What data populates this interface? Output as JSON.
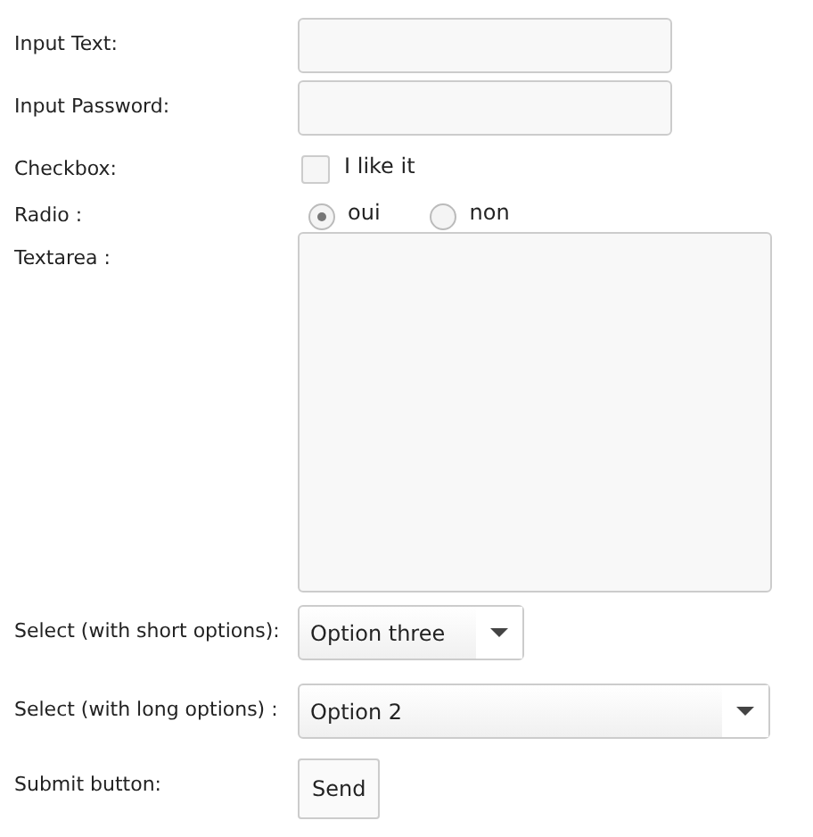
{
  "fields": [
    {
      "kind": "text",
      "label": "Input Text:"
    },
    {
      "kind": "password",
      "label": "Input Password:"
    },
    {
      "kind": "checkbox",
      "label": "Checkbox:",
      "option": "I like it",
      "checked": false
    },
    {
      "kind": "radio",
      "label": "Radio :",
      "options": [
        {
          "label": "oui",
          "selected": true
        },
        {
          "label": "non",
          "selected": false
        }
      ]
    },
    {
      "kind": "textarea",
      "label": "Textarea :"
    },
    {
      "kind": "select-short",
      "label": "Select (with short options):",
      "value": "Option three"
    },
    {
      "kind": "select-long",
      "label": "Select (with long options) :",
      "value": "Option 2"
    },
    {
      "kind": "submit",
      "label": "Submit button:",
      "button": "Send"
    }
  ]
}
